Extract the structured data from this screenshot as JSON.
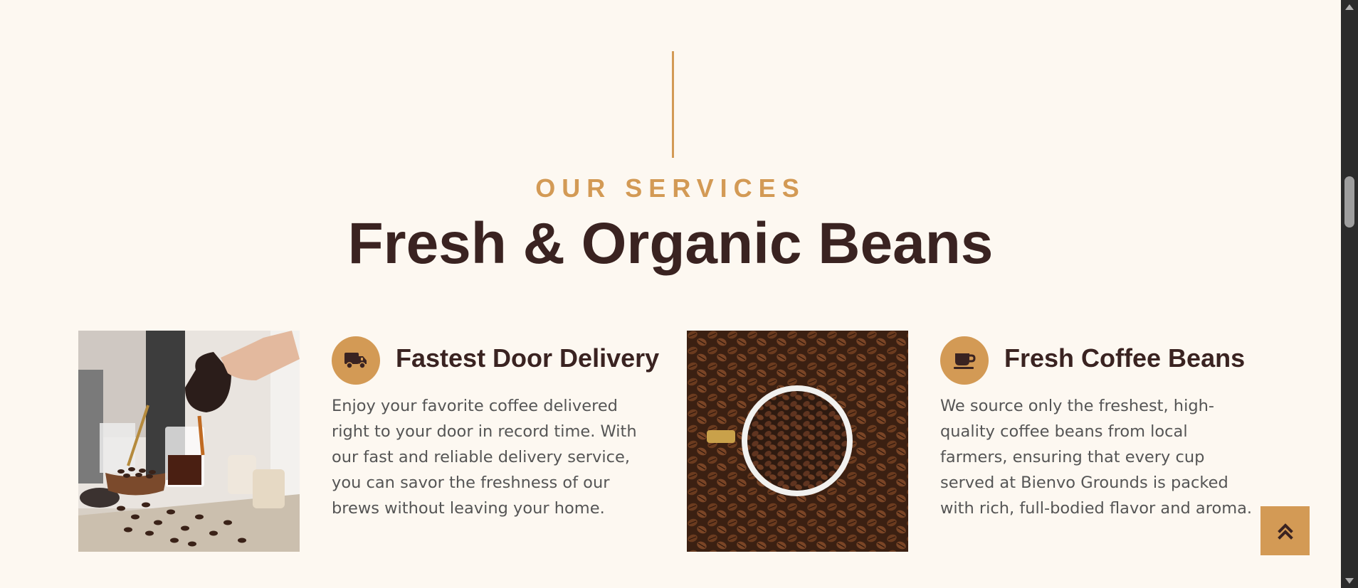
{
  "services_section": {
    "eyebrow": "OUR SERVICES",
    "title": "Fresh & Organic Beans",
    "accent_color": "#d39a55",
    "heading_color": "#3a2321",
    "items": [
      {
        "icon": "truck-icon",
        "title": "Fastest Door Delivery",
        "description": "Enjoy your favorite coffee delivered right to your door in record time. With our fast and reliable delivery service, you can savor the freshness of our brews without leaving your home.",
        "image": "coffee-pour-photo"
      },
      {
        "icon": "coffee-cup-icon",
        "title": "Fresh Coffee Beans",
        "description": "We source only the freshest, high-quality coffee beans from local farmers, ensuring that every cup served at Bienvo Grounds is packed with rich, full-bodied flavor and aroma.",
        "image": "coffee-beans-cup-photo"
      }
    ]
  },
  "back_to_top": {
    "icon": "double-chevron-up-icon"
  }
}
